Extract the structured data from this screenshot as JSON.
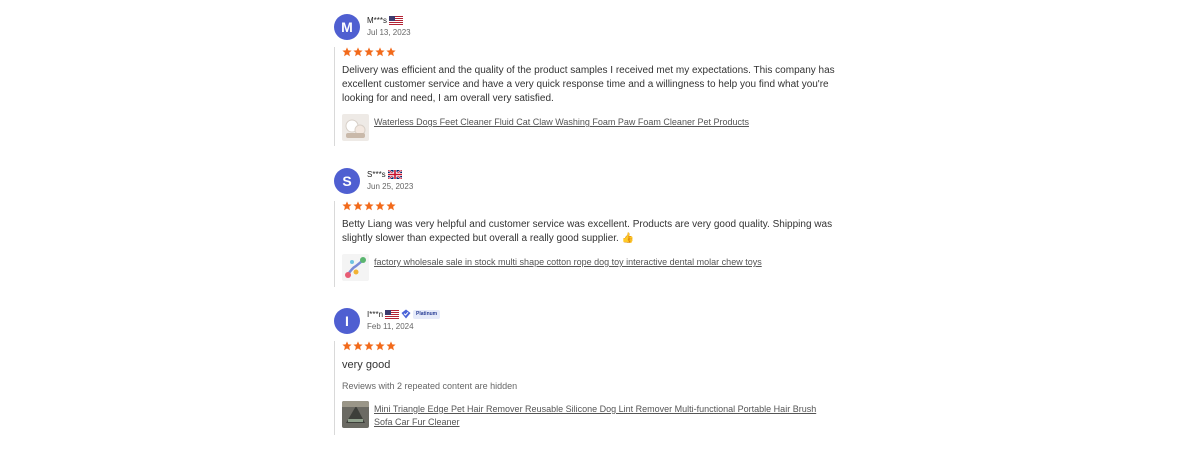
{
  "reviews": [
    {
      "avatar_letter": "M",
      "name": "M***s",
      "country": "United States",
      "date": "Jul 13, 2023",
      "rating": 5,
      "text": "Delivery was efficient and the quality of the product samples I received met my expectations. This company has excellent customer service and have a very quick response time and a willingness to help you find what you're looking for and need, I am overall very satisfied.",
      "product_link": "Waterless Dogs Feet Cleaner Fluid Cat Claw Washing Foam Paw Foam Cleaner Pet Products"
    },
    {
      "avatar_letter": "S",
      "name": "S***s",
      "country": "United Kingdom",
      "date": "Jun 25, 2023",
      "rating": 5,
      "text": "Betty Liang was very helpful and customer service was excellent. Products are very good quality. Shipping was slightly slower than expected but overall a really good supplier. 👍",
      "product_link": "factory wholesale sale in stock multi shape cotton rope dog toy interactive dental molar chew toys"
    },
    {
      "avatar_letter": "I",
      "name": "I***n",
      "country": "United States",
      "badge": "Platinum",
      "date": "Feb 11, 2024",
      "rating": 5,
      "text": "very good",
      "hidden_note": "Reviews with 2 repeated content are hidden",
      "product_link": "Mini Triangle Edge Pet Hair Remover Reusable Silicone Dog Lint Remover Multi-functional Portable Hair Brush Sofa Car Fur Cleaner"
    }
  ],
  "colors": {
    "avatar": "#4f5fd1",
    "star": "#f26a1b",
    "badge_bg": "#e6ebfa",
    "badge_text": "#2a3f96"
  }
}
